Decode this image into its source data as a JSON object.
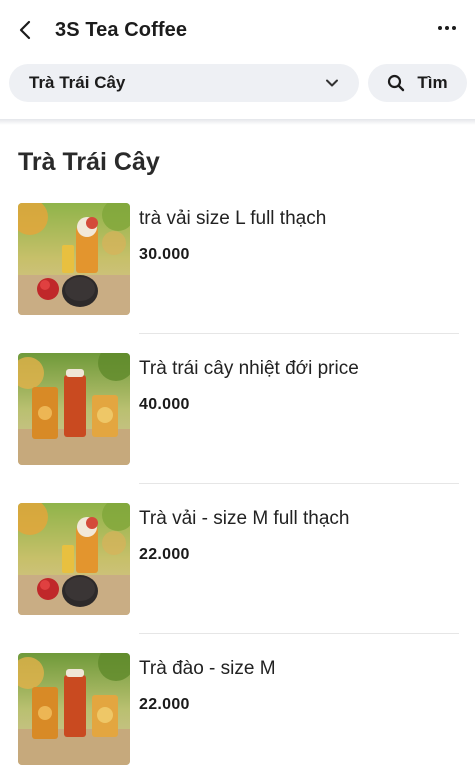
{
  "header": {
    "title": "3S Tea Coffee",
    "back_icon": "chevron-left-icon",
    "more_icon": "more-horizontal-icon"
  },
  "filter": {
    "category": "Trà Trái Cây",
    "dropdown_icon": "chevron-down-icon",
    "search_label": "Tìm",
    "search_icon": "search-icon"
  },
  "section": {
    "title": "Trà Trái Cây"
  },
  "products": [
    {
      "name": "trà vải size L full thạch",
      "price": "30.000",
      "image": "lychee-tea-photo"
    },
    {
      "name": "Trà trái cây nhiệt đới price",
      "price": "40.000",
      "image": "tropical-fruit-tea-photo"
    },
    {
      "name": "Trà vải - size M full thạch",
      "price": "22.000",
      "image": "lychee-tea-photo"
    },
    {
      "name": "Trà đào - size M",
      "price": "22.000",
      "image": "peach-tea-photo"
    }
  ]
}
